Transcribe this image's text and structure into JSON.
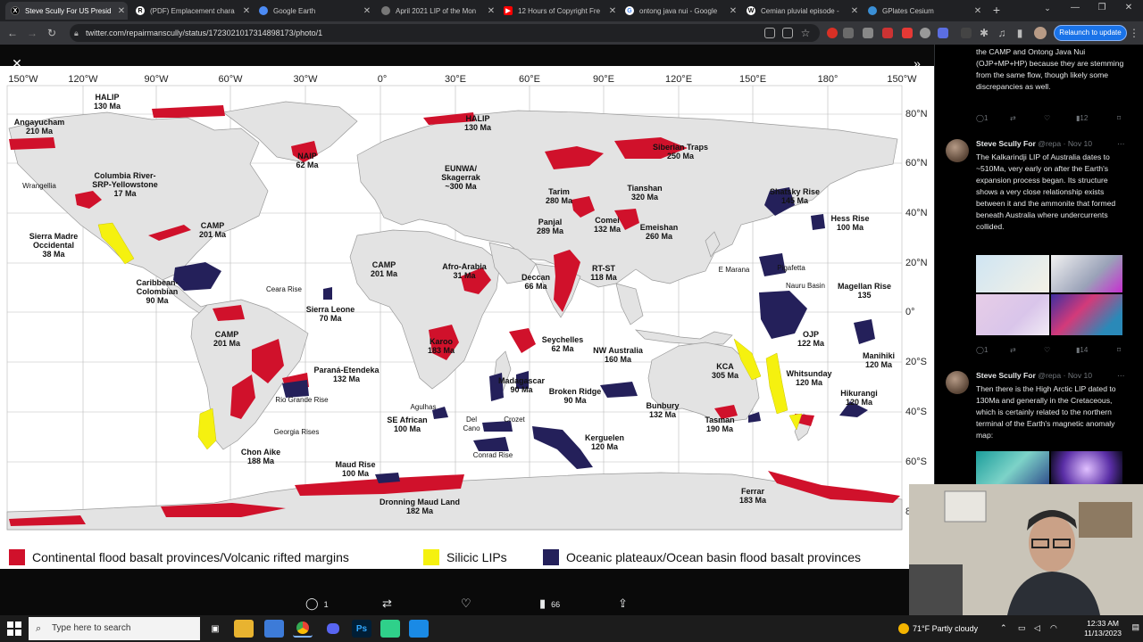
{
  "browser": {
    "tabs": [
      {
        "label": "Steve Scully For US Presid",
        "icon": "x-logo-icon",
        "active": true
      },
      {
        "label": "(PDF) Emplacement chara",
        "icon": "pdf-icon"
      },
      {
        "label": "Google Earth",
        "icon": "google-earth-icon"
      },
      {
        "label": "April 2021 LIP of the Mon",
        "icon": "globe-icon"
      },
      {
        "label": "12 Hours of Copyright Fre",
        "icon": "youtube-icon"
      },
      {
        "label": "ontong java nui - Google",
        "icon": "google-icon"
      },
      {
        "label": "Cemian pluvial episode -",
        "icon": "wikipedia-icon"
      },
      {
        "label": "GPlates Cesium",
        "icon": "globe-icon"
      }
    ],
    "url": "twitter.com/repairmanscully/status/1723021017314898173/photo/1",
    "relaunch_label": "Relaunch to update"
  },
  "map": {
    "longitudes": [
      "150°W",
      "120°W",
      "90°W",
      "60°W",
      "30°W",
      "0°",
      "30°E",
      "60°E",
      "90°E",
      "120°E",
      "150°E",
      "180°",
      "150°W"
    ],
    "latitudes": [
      "80°N",
      "60°N",
      "40°N",
      "20°N",
      "0°",
      "20°S",
      "40°S",
      "60°S",
      "8"
    ],
    "labels": [
      "HALIP\n130 Ma",
      "Angayucham\n210 Ma",
      "Wrangellia",
      "Columbia River-\nSRP-Yellowstone\n17 Ma",
      "Sierra Madre\nOccidental\n38 Ma",
      "CAMP\n201 Ma",
      "NAIP\n62 Ma",
      "HALIP\n130 Ma",
      "EUNWA/\nSkagerrak\n~300 Ma",
      "Siberian Traps\n250 Ma",
      "Tarim\n280 Ma",
      "Tianshan\n320 Ma",
      "Panjal\n289 Ma",
      "Comei\n132 Ma",
      "Emeishan\n260 Ma",
      "Shatsky Rise\n145 Ma",
      "Hess Rise\n100 Ma",
      "CAMP\n201 Ma",
      "Afro-Arabia\n31 Ma",
      "Deccan\n66 Ma",
      "RT-ST\n118 Ma",
      "E Marana",
      "Pigafetta",
      "Nauru Basin",
      "Magellan Rise\n135",
      "Caribbean-\nColombian\n90 Ma",
      "Ceara Rise",
      "Sierra Leone\n70 Ma",
      "OJP\n122 Ma",
      "CAMP\n201 Ma",
      "Karoo\n183 Ma",
      "Seychelles\n62 Ma",
      "NW Australia\n160 Ma",
      "Manihiki\n120 Ma",
      "Paraná-Etendeka\n132 Ma",
      "Madagascar\n90 Ma",
      "KCA\n305 Ma",
      "Whitsunday\n120 Ma",
      "Rio Grande Rise",
      "Broken Ridge\n90 Ma",
      "Hikurangi\n120 Ma",
      "Agulhas",
      "SE African\n100 Ma",
      "Del\nCano",
      "Crozet",
      "Bunbury\n132 Ma",
      "Tasman\n190 Ma",
      "Georgia Rises",
      "Conrad Rise",
      "Kerguelen\n120 Ma",
      "Chon Aike\n188 Ma",
      "Maud Rise\n100 Ma",
      "Dronning Maud Land\n182 Ma",
      "Ferrar\n183 Ma"
    ],
    "legend": [
      {
        "label": "Continental flood basalt provinces/Volcanic rifted margins",
        "color": "#d0112b"
      },
      {
        "label": "Silicic LIPs",
        "color": "#f5f10f"
      },
      {
        "label": "Oceanic plateaux/Ocean basin flood basalt provinces",
        "color": "#24205a"
      }
    ]
  },
  "post_actions": {
    "replies": "1",
    "views": "66"
  },
  "timeline": {
    "tweet0": {
      "text": "the CAMP and Ontong Java Nui (OJP+MP+HP) because they are stemming from the same flow, though likely some discrepancies as well.",
      "replies": "1",
      "views": "12"
    },
    "tweet1": {
      "name": "Steve Scully For",
      "handle": "@repa",
      "date": "· Nov 10",
      "text": "The Kalkarindji LIP of Australia dates to ~510Ma, very early on after the Earth's expansion process began. Its structure shows a very close relationship exists between it and the ammonite that formed beneath Australia where undercurrents collided.",
      "replies": "1",
      "views": "14"
    },
    "tweet2": {
      "name": "Steve Scully For",
      "handle": "@repa",
      "date": "· Nov 10",
      "text": "Then there is the High Arctic LIP dated to 130Ma and generally in the Cretaceous, which is certainly related to the northern terminal of the Earth's magnetic anomaly map:"
    }
  },
  "taskbar": {
    "search_placeholder": "Type here to search",
    "weather": "71°F  Partly cloudy",
    "time": "12:33 AM",
    "date": "11/13/2023"
  }
}
